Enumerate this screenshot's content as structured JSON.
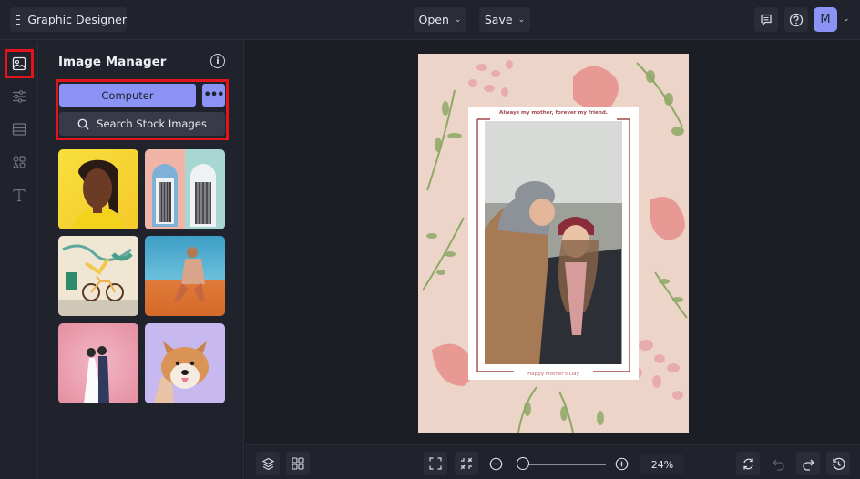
{
  "topbar": {
    "app_title": "Graphic Designer",
    "menu_icon": "hamburger-icon",
    "open_label": "Open",
    "save_label": "Save",
    "comment_icon": "comment-icon",
    "help_icon": "help-icon",
    "avatar_initial": "M",
    "chevron": "⌄"
  },
  "rail": {
    "items": [
      {
        "name": "image-manager",
        "icon": "image-icon",
        "active": true
      },
      {
        "name": "adjustments",
        "icon": "sliders-icon",
        "active": false
      },
      {
        "name": "layouts",
        "icon": "layout-icon",
        "active": false
      },
      {
        "name": "graphics",
        "icon": "shapes-icon",
        "active": false
      },
      {
        "name": "text",
        "icon": "text-icon",
        "active": false
      }
    ]
  },
  "panel": {
    "title": "Image Manager",
    "info_icon": "i",
    "computer_label": "Computer",
    "more_label": "•••",
    "search_label": "Search Stock Images",
    "thumbnails": [
      {
        "alt": "Woman on yellow background"
      },
      {
        "alt": "Pastel doorways"
      },
      {
        "alt": "Bicycle by mural wall"
      },
      {
        "alt": "Man sitting on desert sand"
      },
      {
        "alt": "Wedding couple with pink blossoms"
      },
      {
        "alt": "Shiba Inu dog on purple"
      }
    ]
  },
  "canvas": {
    "quote": "Always my mother, forever my friend.",
    "footer": "Happy Mother's Day",
    "colors": {
      "background": "#ecd5c8",
      "accent": "#a0494e"
    }
  },
  "bottombar": {
    "zoom_level": "24%",
    "zoom_fraction": 0.05
  },
  "colors": {
    "accent": "#8b94f5",
    "highlight": "#e3141b",
    "bg": "#1e2029"
  }
}
